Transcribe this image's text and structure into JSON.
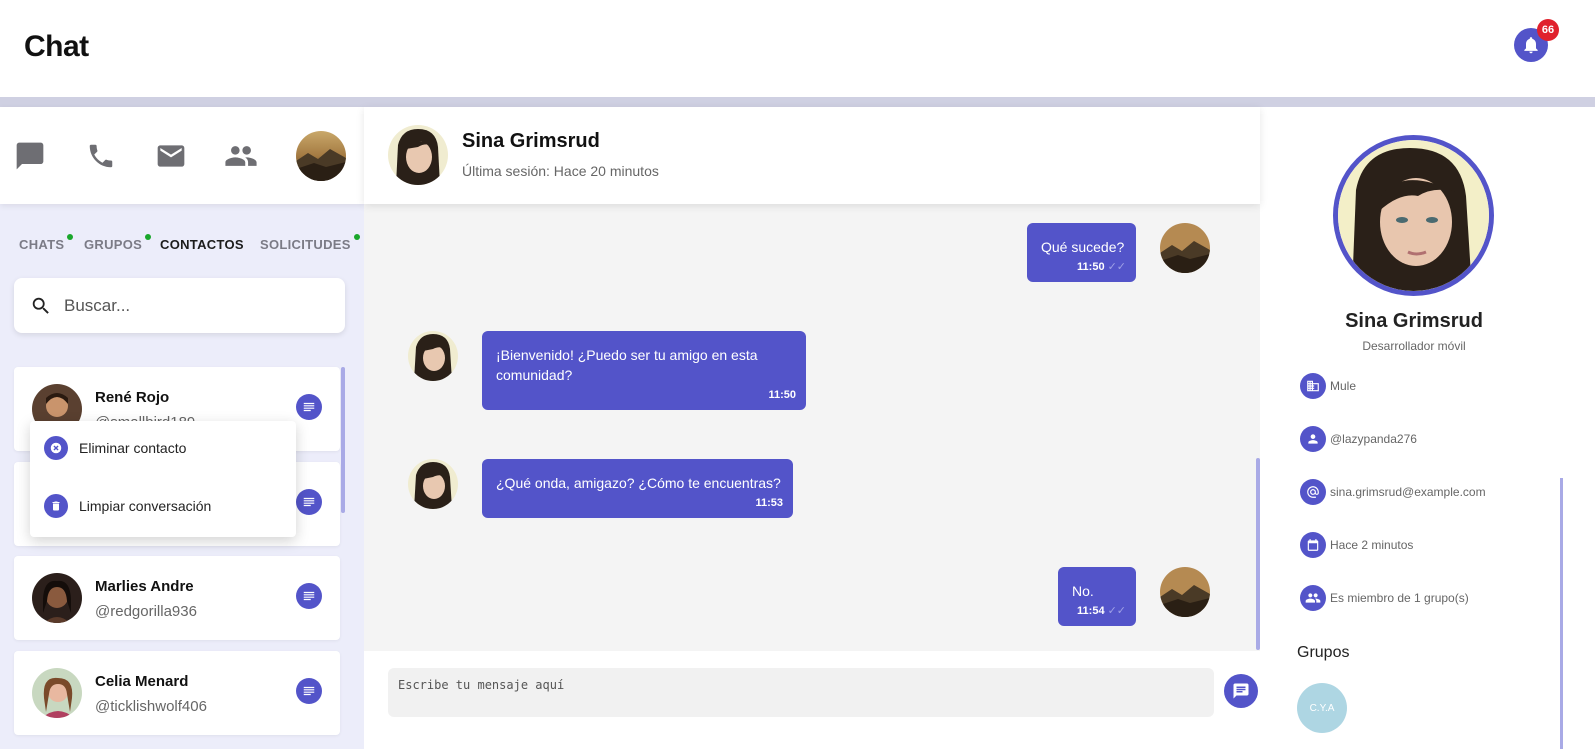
{
  "app": {
    "title": "Chat",
    "notification_count": "66"
  },
  "nav_icons": [
    "chat-icon",
    "phone-icon",
    "mail-icon",
    "people-icon"
  ],
  "tabs": [
    {
      "label": "CHATS",
      "dot": true
    },
    {
      "label": "GRUPOS",
      "dot": true
    },
    {
      "label": "CONTACTOS",
      "dot": false,
      "active": true
    },
    {
      "label": "SOLICITUDES",
      "dot": true
    }
  ],
  "search": {
    "placeholder": "Buscar..."
  },
  "contacts": [
    {
      "name": "René Rojo",
      "username": "@smallbird189"
    },
    {
      "name": "",
      "username": ""
    },
    {
      "name": "Marlies Andre",
      "username": "@redgorilla936"
    },
    {
      "name": "Celia Menard",
      "username": "@ticklishwolf406"
    }
  ],
  "contact_menu": {
    "items": [
      {
        "label": "Eliminar contacto",
        "icon": "close-circle-icon"
      },
      {
        "label": "Limpiar conversación",
        "icon": "trash-icon"
      }
    ]
  },
  "chat": {
    "contact_name": "Sina Grimsrud",
    "last_seen": "Última sesión: Hace 20 minutos",
    "messages": [
      {
        "text": "Qué sucede?",
        "time": "11:50",
        "mine": true,
        "read": true
      },
      {
        "text": "¡Bienvenido! ¿Puedo ser tu amigo en esta comunidad?",
        "time": "11:50",
        "mine": false
      },
      {
        "text": "¿Qué onda, amigazo? ¿Cómo te encuentras?",
        "time": "11:53",
        "mine": false
      },
      {
        "text": "No.",
        "time": "11:54",
        "mine": true,
        "read": true
      }
    ],
    "composer_placeholder": "Escribe tu mensaje aquí"
  },
  "profile": {
    "name": "Sina Grimsrud",
    "role": "Desarrollador móvil",
    "details": [
      {
        "icon": "building-icon",
        "text": "Mule"
      },
      {
        "icon": "person-icon",
        "text": "@lazypanda276"
      },
      {
        "icon": "at-icon",
        "text": "sina.grimsrud@example.com"
      },
      {
        "icon": "calendar-icon",
        "text": "Hace 2 minutos"
      },
      {
        "icon": "group-icon",
        "text": "Es miembro de 1 grupo(s)"
      }
    ],
    "groups_title": "Grupos",
    "groups": [
      {
        "label": "C.Y.A"
      }
    ]
  },
  "colors": {
    "accent": "#5354c9",
    "badge": "#e0212d",
    "online": "#1aa72b"
  }
}
